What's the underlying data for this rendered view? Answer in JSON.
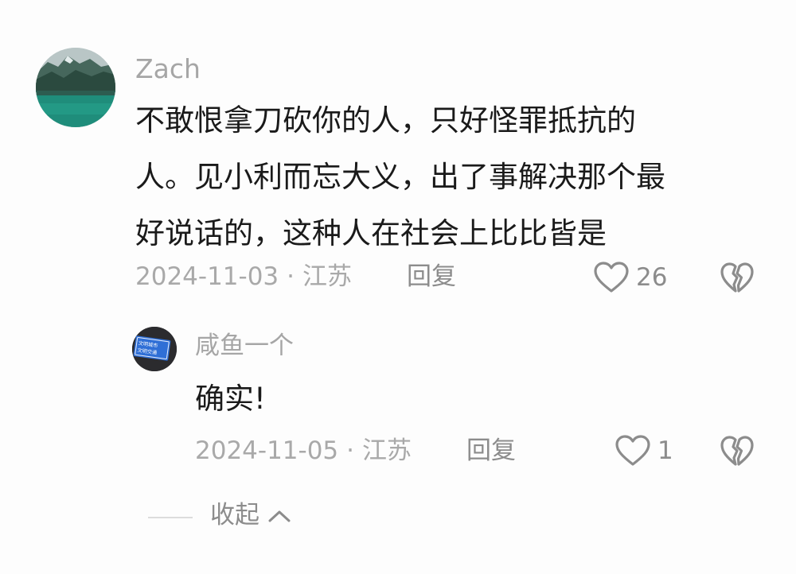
{
  "comment": {
    "username": "Zach",
    "text_lines": [
      "不敢恨拿刀砍你的人，只好怪罪抵抗的",
      "人。见小利而忘大义，出了事解决那个最",
      "好说话的，这种人在社会上比比皆是"
    ],
    "date": "2024-11-03",
    "separator": "·",
    "location": "江苏",
    "reply_label": "回复",
    "like_count": "26",
    "icons": {
      "like": "heart-outline-icon",
      "dislike": "broken-heart-icon"
    },
    "reply": {
      "username": "咸鱼一个",
      "text": "确实!",
      "date": "2024-11-05",
      "separator": "·",
      "location": "江苏",
      "reply_label": "回复",
      "like_count": "1",
      "avatar_sign_text": [
        "文明城市",
        "文明交通"
      ]
    }
  },
  "collapse": {
    "label": "收起",
    "icon": "chevron-up-icon"
  },
  "colors": {
    "text_primary": "#1a1a1a",
    "text_secondary": "#a6a6a6",
    "icon_gray": "#8c8c8c",
    "background": "#fdfdfd",
    "sign_blue": "#2f6fd6"
  }
}
